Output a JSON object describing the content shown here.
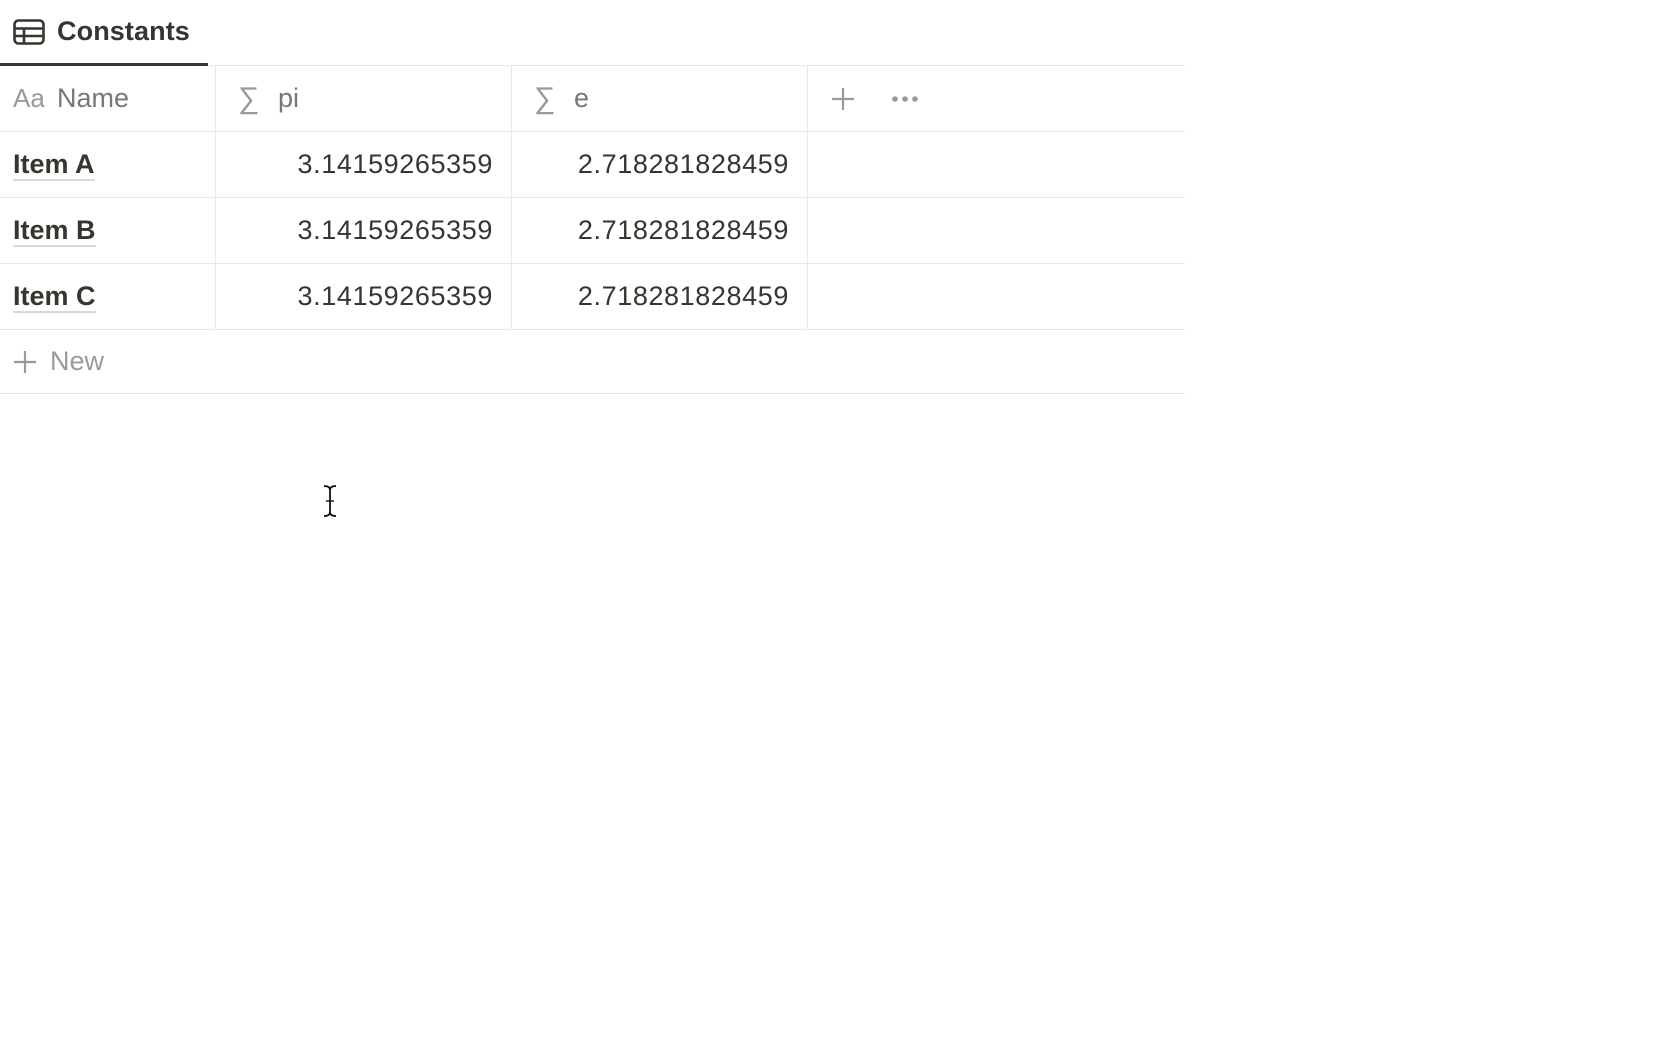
{
  "tab": {
    "label": "Constants",
    "icon": "table-icon"
  },
  "table": {
    "columns": [
      {
        "label": "Name",
        "icon": "Aa"
      },
      {
        "label": "pi",
        "icon": "∑"
      },
      {
        "label": "e",
        "icon": "∑"
      }
    ],
    "add_column_icon": "plus-icon",
    "more_icon": "ellipsis-icon",
    "rows": [
      {
        "name": "Item A",
        "pi": "3.14159265359",
        "e": "2.718281828459"
      },
      {
        "name": "Item B",
        "pi": "3.14159265359",
        "e": "2.718281828459"
      },
      {
        "name": "Item C",
        "pi": "3.14159265359",
        "e": "2.718281828459"
      }
    ],
    "new_row_label": "New"
  },
  "colors": {
    "text": "#37352f",
    "muted": "#787774",
    "border": "#e9e9e7",
    "tab_underline": "#37352f"
  }
}
